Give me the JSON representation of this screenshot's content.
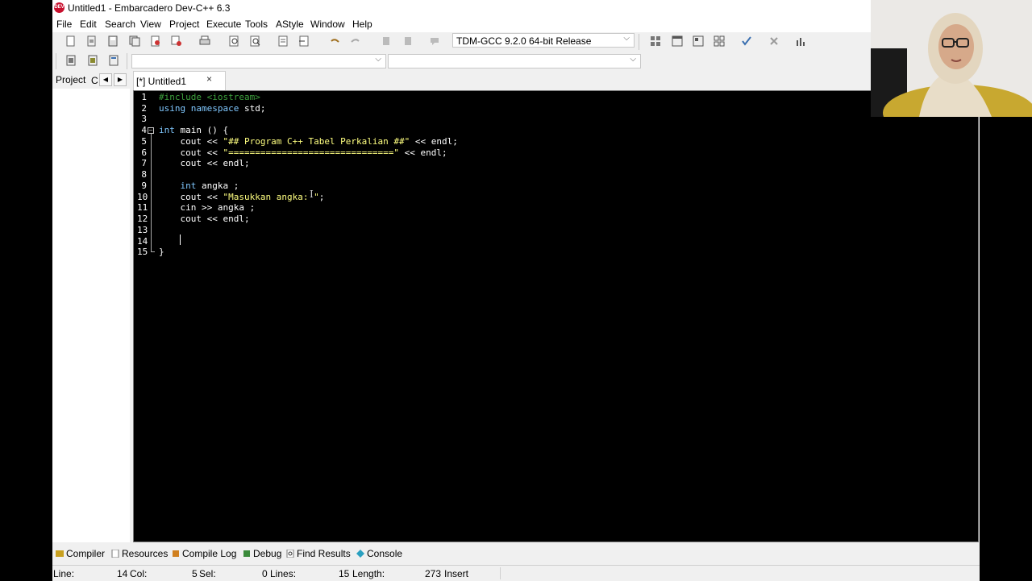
{
  "window": {
    "title": "Untitled1 - Embarcadero Dev-C++ 6.3",
    "logo_text": "DEV"
  },
  "menu": [
    "File",
    "Edit",
    "Search",
    "View",
    "Project",
    "Execute",
    "Tools",
    "AStyle",
    "Window",
    "Help"
  ],
  "toolbar": {
    "compiler_select": "TDM-GCC 9.2.0 64-bit Release",
    "class_select": "",
    "member_select": ""
  },
  "left_panel": {
    "tab_project": "Project",
    "tab_classes": "C"
  },
  "editor": {
    "tab_label": "[*] Untitled1",
    "tab_close": "×",
    "line_numbers": [
      "1",
      "2",
      "3",
      "4",
      "5",
      "6",
      "7",
      "8",
      "9",
      "10",
      "11",
      "12",
      "13",
      "14",
      "15"
    ],
    "fold_marker": "−"
  },
  "code": {
    "l1": "#include <iostream>",
    "l2_kw": "using namespace",
    "l2_rest": " std;",
    "l4_kw": "int",
    "l4_rest": " main () {",
    "l5_a": "    cout << ",
    "l5_str": "\"## Program C++ Tabel Perkalian ##\"",
    "l5_b": " << endl;",
    "l6_a": "    cout << ",
    "l6_str": "\"===============================\"",
    "l6_b": " << endl;",
    "l7": "    cout << endl;",
    "l9_pad": "    ",
    "l9_kw": "int",
    "l9_rest": " angka ;",
    "l10_a": "    cout << ",
    "l10_str": "\"Masukkan angka: \"",
    "l10_b": ";",
    "l11": "    cin >> angka ;",
    "l12": "    cout << endl;",
    "l15": "}"
  },
  "bottom_tabs": [
    "Compiler",
    "Resources",
    "Compile Log",
    "Debug",
    "Find Results",
    "Console"
  ],
  "status": {
    "line_label": "Line:",
    "line_val": "14",
    "col_label": "Col:",
    "col_val": "5",
    "sel_label": "Sel:",
    "sel_val": "0",
    "lines_label": "Lines:",
    "lines_val": "15",
    "length_label": "Length:",
    "length_val": "273",
    "mode": "Insert"
  },
  "colors": {
    "brand": "#c8102e",
    "keyword": "#80c8ff",
    "preprocessor": "#3ca03c",
    "string": "#ffff80"
  }
}
